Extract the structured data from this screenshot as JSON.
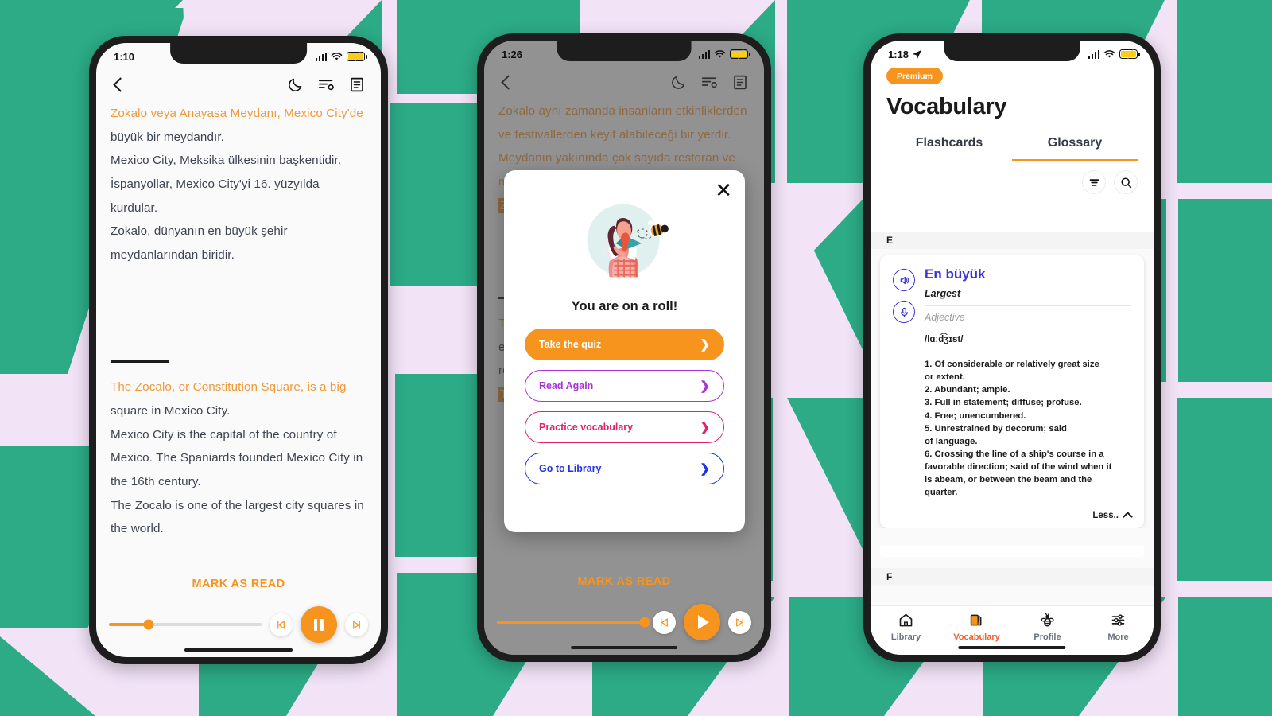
{
  "background": {
    "base_color": "#f2e3f7",
    "accent_color": "#2cab86"
  },
  "phones": [
    {
      "id": "reader-playing",
      "status": {
        "time": "1:10",
        "signal": "signal-bars-icon",
        "wifi": "wifi-icon",
        "battery": "battery-charging-icon"
      },
      "toolbar": {
        "back": "back-chevron-icon",
        "icons": [
          "moon-icon",
          "reading-settings-icon",
          "table-of-contents-icon"
        ]
      },
      "content": {
        "turkish": {
          "highlight": "Zokalo veya Anayasa Meydanı, Mexico City'de",
          "rest": " büyük bir meydandır.",
          "lines": [
            "Mexico City, Meksika ülkesinin başkentidir.",
            "İspanyollar, Mexico City'yi 16. yüzyılda kurdular.",
            "Zokalo, dünyanın en büyük şehir",
            "meydanlarından biridir."
          ]
        },
        "english": {
          "highlight": "The Zocalo, or Constitution Square, is a big",
          "rest": " square in Mexico City.",
          "lines": [
            "Mexico City is the capital of the country of",
            "Mexico. The Spaniards founded Mexico City in",
            "the 16th century.",
            "The Zocalo is one of the largest city squares in",
            "the world."
          ]
        }
      },
      "player": {
        "mark_as_read": "MARK AS READ",
        "progress_percent": 26,
        "previous": "skip-previous-icon",
        "play_state": "pause-icon",
        "next": "skip-next-icon"
      }
    },
    {
      "id": "reader-modal",
      "status": {
        "time": "1:26",
        "signal": "signal-bars-icon",
        "wifi": "wifi-icon",
        "battery": "battery-charging-icon"
      },
      "toolbar": {
        "back": "back-chevron-icon",
        "icons": [
          "moon-icon",
          "reading-settings-icon",
          "table-of-contents-icon"
        ]
      },
      "content": {
        "turkish_lines": [
          "Zokalo aynı zamanda insanların etkinliklerden",
          "ve festivallerden keyif alabileceği bir yerdir.",
          "Meydanın yakınında çok sayıda restoran ve",
          "m"
        ],
        "turkish_boxed": "Zo",
        "english_fragments": [
          "Th",
          "ev",
          "re"
        ],
        "english_boxed": "Th"
      },
      "modal": {
        "close": "close-icon",
        "illustration": "girl-reading-with-bee-illustration",
        "title": "You are on a roll!",
        "buttons": [
          {
            "label": "Take the quiz",
            "style": "filled",
            "color": "#f7941e",
            "text_color": "#ffffff",
            "chevron": "chevron-right-icon"
          },
          {
            "label": "Read Again",
            "style": "outline",
            "color": "#a634d6",
            "text_color": "#a634d6",
            "chevron": "chevron-right-icon"
          },
          {
            "label": "Practice vocabulary",
            "style": "outline",
            "color": "#e0246b",
            "text_color": "#e0246b",
            "chevron": "chevron-right-icon"
          },
          {
            "label": "Go to Library",
            "style": "outline",
            "color": "#2233dd",
            "text_color": "#2233dd",
            "chevron": "chevron-right-icon"
          }
        ]
      },
      "player": {
        "mark_as_read": "MARK AS READ",
        "progress_percent": 100,
        "previous": "skip-previous-icon",
        "play_state": "play-icon",
        "next": "skip-next-icon"
      }
    },
    {
      "id": "vocabulary",
      "status": {
        "time": "1:18",
        "location": "location-arrow-icon",
        "signal": "signal-bars-icon",
        "wifi": "wifi-icon",
        "battery": "battery-charging-icon"
      },
      "header": {
        "badge": "Premium",
        "title": "Vocabulary"
      },
      "tabs": [
        {
          "label": "Flashcards",
          "active": false
        },
        {
          "label": "Glossary",
          "active": true
        }
      ],
      "tools": [
        {
          "name": "filter-icon"
        },
        {
          "name": "search-icon"
        }
      ],
      "sections": [
        {
          "letter": "E"
        },
        {
          "letter": "F"
        }
      ],
      "entry": {
        "audio_icon": "speaker-icon",
        "record_icon": "microphone-icon",
        "word": "En büyük",
        "translation": "Largest",
        "part_of_speech": "Adjective",
        "phonetic": "/lɑːd͡ʒɪst/",
        "definitions": [
          "1. Of considerable or relatively great size",
          "or extent.",
          "2. Abundant; ample.",
          "3. Full in statement; diffuse; profuse.",
          "4. Free; unencumbered.",
          "5. Unrestrained by decorum; said",
          "of language.",
          "6. Crossing the line of a ship's course in a",
          "favorable direction; said of the wind when it",
          "is abeam, or between the beam and the",
          "quarter."
        ],
        "toggle_label": "Less..",
        "toggle_icon": "chevron-up-icon"
      },
      "tabbar": [
        {
          "label": "Library",
          "icon": "home-icon",
          "active": false
        },
        {
          "label": "Vocabulary",
          "icon": "cards-icon",
          "active": true
        },
        {
          "label": "Profile",
          "icon": "bee-icon",
          "active": false
        },
        {
          "label": "More",
          "icon": "sliders-icon",
          "active": false
        }
      ]
    }
  ]
}
